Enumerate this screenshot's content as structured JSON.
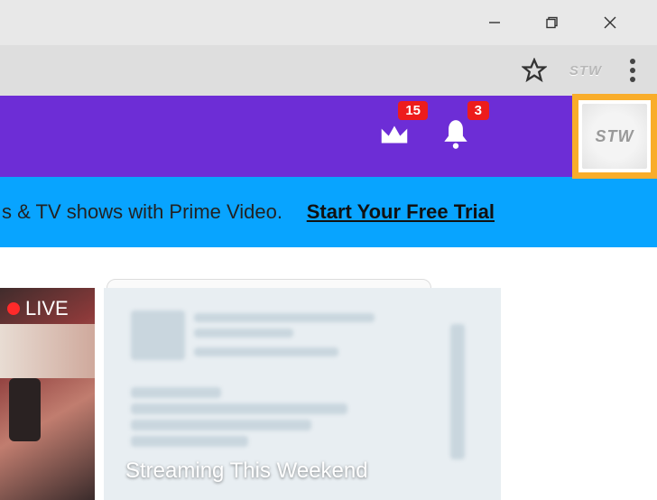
{
  "ext_label": "STW",
  "header": {
    "crown_badge": "15",
    "bell_badge": "3",
    "avatar_text": "STW"
  },
  "promo": {
    "text": "s & TV shows with Prime Video.",
    "cta": "Start Your Free Trial"
  },
  "content": {
    "live_label": "LIVE",
    "thumb_title": "Streaming This Weekend"
  }
}
